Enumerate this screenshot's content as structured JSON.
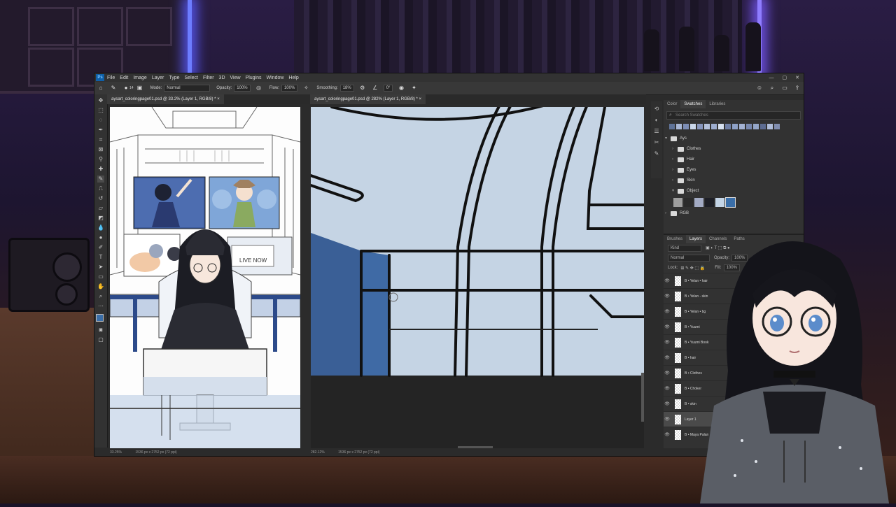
{
  "menubar": {
    "logo": "Ps",
    "items": [
      "File",
      "Edit",
      "Image",
      "Layer",
      "Type",
      "Select",
      "Filter",
      "3D",
      "View",
      "Plugins",
      "Window",
      "Help"
    ],
    "window_controls": [
      "—",
      "▢",
      "✕"
    ]
  },
  "options": {
    "brush_size": "14",
    "mode_label": "Mode:",
    "mode_value": "Normal",
    "opacity_label": "Opacity:",
    "opacity_value": "100%",
    "flow_label": "Flow:",
    "flow_value": "100%",
    "smoothing_label": "Smoothing:",
    "smoothing_value": "18%",
    "angle_value": "0°"
  },
  "tabs": {
    "doc1": "aysart_coloringpage01.psd @ 33.2% (Layer 1, RGB/8) *",
    "doc2": "aysart_coloringpage01.psd @ 282% (Layer 1, RGB/8) *",
    "close": "×"
  },
  "artwork": {
    "live_label": "LIVE NOW"
  },
  "status": {
    "doc1_zoom": "33.25%",
    "doc1_size": "1536 px x 2752 px (72 ppi)",
    "doc2_zoom": "282.12%",
    "doc2_size": "1536 px x 2752 px (72 ppi)"
  },
  "swatches": {
    "tabs": [
      "Color",
      "Swatches",
      "Libraries"
    ],
    "search_placeholder": "Search Swatches",
    "top_colors": [
      "#5f7398",
      "#a9b8d6",
      "#7c8db5",
      "#c9d6ea",
      "#8796bd",
      "#b5c2dc",
      "#9dadcf",
      "#d7e1f0",
      "#6f7fa5",
      "#8ea1c7",
      "#a3b2d4",
      "#7888b0",
      "#94a6c9",
      "#5d6c92",
      "#b0bedb",
      "#818eb0"
    ],
    "group_root": "Ays",
    "groups": [
      "Clothes",
      "Hair",
      "Eyes",
      "Skin",
      "Object"
    ],
    "object_colors": [
      "#9e9e9e",
      "#2b2b2b",
      "#a3abc4",
      "#1e1f26",
      "#c3d4e6",
      "#3a6ea8"
    ],
    "rgb_group": "RGB"
  },
  "layers": {
    "tabs": [
      "Brushes",
      "Layers",
      "Channels",
      "Paths"
    ],
    "kind_label": "Kind",
    "blend_mode": "Normal",
    "opacity_label": "Opacity:",
    "opacity_value": "100%",
    "lock_label": "Lock:",
    "fill_label": "Fill:",
    "fill_value": "100%",
    "items": [
      {
        "name": "B • Yelan • hair",
        "selected": false
      },
      {
        "name": "B • Yelan - skin",
        "selected": false
      },
      {
        "name": "B • Yelan • bg",
        "selected": false
      },
      {
        "name": "B • Yuumi",
        "selected": false
      },
      {
        "name": "B • Yuumi Book",
        "selected": false
      },
      {
        "name": "B • hair",
        "selected": false
      },
      {
        "name": "B • Clothes",
        "selected": false
      },
      {
        "name": "B • Choker",
        "selected": false
      },
      {
        "name": "B • skin",
        "selected": false
      },
      {
        "name": "Layer 1",
        "selected": true
      },
      {
        "name": "B • Maya Palan",
        "selected": false
      }
    ]
  },
  "colors": {
    "ps_bg": "#2b2b2b",
    "panel_bg": "#323232",
    "canvas_blue": "#c5d4e4",
    "accent_blue": "#3a6ea8"
  }
}
